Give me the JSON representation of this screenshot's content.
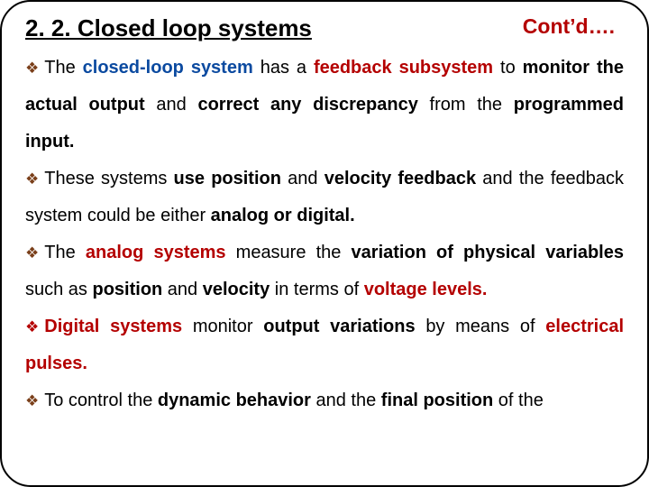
{
  "header": {
    "title": "2. 2. Closed loop systems",
    "contd": "Cont’d…."
  },
  "p1": {
    "t0": "The ",
    "closed_loop": "closed-loop system",
    "t1": " has a ",
    "feedback_sub": "feedback subsystem",
    "t2": " to ",
    "monitor": "monitor the actual output",
    "t3": " and ",
    "correct": "correct any discrepancy",
    "t4": " from the ",
    "prog_input": "programmed input."
  },
  "p2": {
    "t0": "These systems ",
    "use_pos": "use position",
    "t1": " and ",
    "vel_fb": "velocity feedback",
    "t2": " and the feedback system could be either ",
    "analog_digital": "analog or digital."
  },
  "p3": {
    "t0": "The ",
    "analog_sys": "analog systems",
    "t1": " measure the ",
    "variation_phys": "variation of physical variables",
    "t2": " such as ",
    "position": "position",
    "t3": " and ",
    "velocity": "velocity",
    "t4": " in terms of ",
    "voltage_levels": "voltage levels."
  },
  "p4": {
    "digital_sys": "Digital systems",
    "t0": " monitor ",
    "output_var": "output variations",
    "t1": " by means of ",
    "elec_pulses": "electrical pulses."
  },
  "p5": {
    "t0": "To control the ",
    "dyn_behavior": "dynamic behavior",
    "t1": " and the ",
    "final_pos": "final position",
    "t2": " of the"
  }
}
